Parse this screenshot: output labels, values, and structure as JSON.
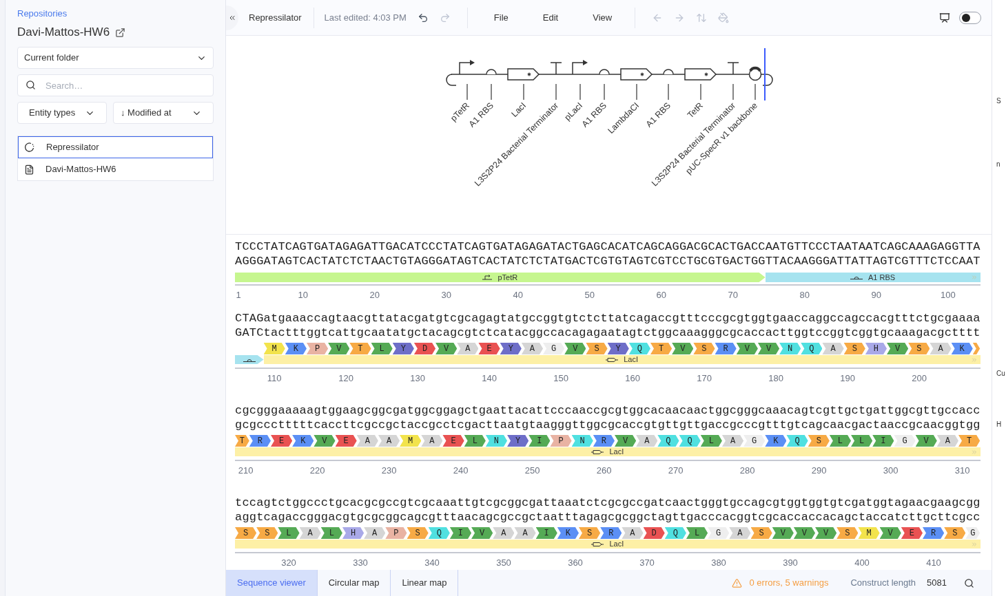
{
  "sidebar": {
    "breadcrumb": "Repositories",
    "title": "Davi-Mattos-HW6",
    "folder_select": "Current folder",
    "search": {
      "placeholder": "Search…"
    },
    "filters": [
      {
        "label": "Entity types"
      },
      {
        "label": "↓ Modified at"
      }
    ],
    "items": [
      {
        "kind": "construct",
        "label": "Repressilator",
        "selected": true
      },
      {
        "kind": "document",
        "label": "Davi-Mattos-HW6",
        "selected": false
      }
    ]
  },
  "toolbar": {
    "document_title": "Repressilator",
    "last_edited": "Last edited: 4:03 PM",
    "history": [
      {
        "kind": "undo",
        "disabled": false
      },
      {
        "kind": "redo",
        "disabled": true
      }
    ],
    "menus": [
      "File",
      "Edit",
      "View"
    ],
    "tools": [
      {
        "kind": "back",
        "disabled": true
      },
      {
        "kind": "forward",
        "disabled": true
      },
      {
        "kind": "flip",
        "disabled": true
      },
      {
        "kind": "paint",
        "disabled": true
      }
    ],
    "preview_toggle": {
      "on": false
    }
  },
  "diagram": {
    "parts": [
      {
        "kind": "promoter",
        "label": "pTetR"
      },
      {
        "kind": "rbs",
        "label": "A1 RBS"
      },
      {
        "kind": "cds",
        "label": "LacI"
      },
      {
        "kind": "terminator",
        "label": "L3S2P24 Bacterial Terminator"
      },
      {
        "kind": "promoter",
        "label": "pLacI"
      },
      {
        "kind": "rbs",
        "label": "A1 RBS"
      },
      {
        "kind": "cds",
        "label": "LambdaCI"
      },
      {
        "kind": "rbs",
        "label": "A1 RBS"
      },
      {
        "kind": "cds",
        "label": "TetR"
      },
      {
        "kind": "terminator",
        "label": "L3S2P24 Bacterial Terminator"
      },
      {
        "kind": "origin",
        "label": "pUC-SpecR v1 backbone"
      }
    ]
  },
  "sequence": {
    "lines": [
      {
        "top": "TCCCTATCAGTGATAGAGATTGACATCCCTATCAGTGATAGAGATACTGAGCACATCAGCAGGACGCACTGACCAATGTTCCCTAATAATCAGCAAAGAGGTTA",
        "bottom": "AGGGATAGTCACTATCTCTAACTGTAGGGATAGTCACTATCTCTATGACTCGTGTAGTCGTCCTGCGTGACTGGTTACAAGGGATTATTAGTCGTTTCTCCAAT",
        "features": [
          {
            "kind": "promoter",
            "label": "pTetR",
            "color": "#c6f68f",
            "continues": false
          },
          {
            "kind": "rbs",
            "label": "A1 RBS",
            "color": "#a6e3ef",
            "continues": true
          }
        ],
        "ticks": [
          "1",
          "10",
          "20",
          "30",
          "40",
          "50",
          "60",
          "70",
          "80",
          "90",
          "100"
        ]
      },
      {
        "top": "CTAGatgaaaccagtaacgttatacgatgtcgcagagtatgccggtgtctcttatcagaccgtttcccgcgtggtgaaccaggccagccacgtttctgcgaaaa",
        "bottom": "GATCtactttggtcattgcaatatgctacagcgtctcatacggccacagagaatagtctggcaaagggcgcaccacttggtccggtcggtgcaaagacgctttt",
        "aminos": [
          {
            "kind": "gap"
          },
          {
            "kind": "codon",
            "letter": "M",
            "color": "#f2e34c"
          },
          {
            "kind": "codon",
            "letter": "K",
            "color": "#5b8ff5"
          },
          {
            "kind": "codon",
            "letter": "P",
            "color": "#e9b3a3"
          },
          {
            "kind": "codon",
            "letter": "V",
            "color": "#55aa55"
          },
          {
            "kind": "codon",
            "letter": "T",
            "color": "#f7aa45"
          },
          {
            "kind": "codon",
            "letter": "L",
            "color": "#55aa55"
          },
          {
            "kind": "codon",
            "letter": "Y",
            "color": "#6e6ec8"
          },
          {
            "kind": "codon",
            "letter": "D",
            "color": "#e95252"
          },
          {
            "kind": "codon",
            "letter": "V",
            "color": "#55aa55"
          },
          {
            "kind": "codon",
            "letter": "A",
            "color": "#d5d5d5"
          },
          {
            "kind": "codon",
            "letter": "E",
            "color": "#e95252"
          },
          {
            "kind": "codon",
            "letter": "Y",
            "color": "#6e6ec8"
          },
          {
            "kind": "codon",
            "letter": "A",
            "color": "#d5d5d5"
          },
          {
            "kind": "codon",
            "letter": "G",
            "color": "#eeeeee"
          },
          {
            "kind": "codon",
            "letter": "V",
            "color": "#55aa55"
          },
          {
            "kind": "codon",
            "letter": "S",
            "color": "#f7aa45"
          },
          {
            "kind": "codon",
            "letter": "Y",
            "color": "#6e6ec8"
          },
          {
            "kind": "codon",
            "letter": "Q",
            "color": "#50e0e0"
          },
          {
            "kind": "codon",
            "letter": "T",
            "color": "#f7aa45"
          },
          {
            "kind": "codon",
            "letter": "V",
            "color": "#55aa55"
          },
          {
            "kind": "codon",
            "letter": "S",
            "color": "#f7aa45"
          },
          {
            "kind": "codon",
            "letter": "R",
            "color": "#5b8ff5"
          },
          {
            "kind": "codon",
            "letter": "V",
            "color": "#55aa55"
          },
          {
            "kind": "codon",
            "letter": "V",
            "color": "#55aa55"
          },
          {
            "kind": "codon",
            "letter": "N",
            "color": "#50e0e0"
          },
          {
            "kind": "codon",
            "letter": "Q",
            "color": "#50e0e0"
          },
          {
            "kind": "codon",
            "letter": "A",
            "color": "#d5d5d5"
          },
          {
            "kind": "codon",
            "letter": "S",
            "color": "#f7aa45"
          },
          {
            "kind": "codon",
            "letter": "H",
            "color": "#a9a9e8"
          },
          {
            "kind": "codon",
            "letter": "V",
            "color": "#55aa55"
          },
          {
            "kind": "codon",
            "letter": "S",
            "color": "#f7aa45"
          },
          {
            "kind": "codon",
            "letter": "A",
            "color": "#d5d5d5"
          },
          {
            "kind": "codon",
            "letter": "K",
            "color": "#5b8ff5"
          },
          {
            "kind": "tail1",
            "color": "#f7aa45"
          }
        ],
        "features": [
          {
            "kind": "rbs",
            "color": "#a6e3ef",
            "continues": false
          },
          {
            "kind": "cds",
            "label": "LacI",
            "color": "#fdf0a6",
            "continues": true
          }
        ],
        "ticks": [
          "110",
          "120",
          "130",
          "140",
          "150",
          "160",
          "170",
          "180",
          "190",
          "200"
        ]
      },
      {
        "top": "cgcgggaaaaagtggaagcggcgatggcggagctgaattacattcccaaccgcgtggcacaacaactggcgggcaaacagtcgttgctgattggcgttgccacc",
        "bottom": "gcgccctttttcaccttcgccgctaccgcctcgacttaatgtaagggttggcgcaccgtgttgttgaccgcccgtttgtcagcaacgactaaccgcaacggtgg",
        "aminos": [
          {
            "kind": "head2",
            "letter": "T",
            "color": "#f7aa45"
          },
          {
            "kind": "codon",
            "letter": "R",
            "color": "#5b8ff5"
          },
          {
            "kind": "codon",
            "letter": "E",
            "color": "#e95252"
          },
          {
            "kind": "codon",
            "letter": "K",
            "color": "#5b8ff5"
          },
          {
            "kind": "codon",
            "letter": "V",
            "color": "#55aa55"
          },
          {
            "kind": "codon",
            "letter": "E",
            "color": "#e95252"
          },
          {
            "kind": "codon",
            "letter": "A",
            "color": "#d5d5d5"
          },
          {
            "kind": "codon",
            "letter": "A",
            "color": "#d5d5d5"
          },
          {
            "kind": "codon",
            "letter": "M",
            "color": "#f2e34c"
          },
          {
            "kind": "codon",
            "letter": "A",
            "color": "#d5d5d5"
          },
          {
            "kind": "codon",
            "letter": "E",
            "color": "#e95252"
          },
          {
            "kind": "codon",
            "letter": "L",
            "color": "#55aa55"
          },
          {
            "kind": "codon",
            "letter": "N",
            "color": "#50e0e0"
          },
          {
            "kind": "codon",
            "letter": "Y",
            "color": "#6e6ec8"
          },
          {
            "kind": "codon",
            "letter": "I",
            "color": "#55aa55"
          },
          {
            "kind": "codon",
            "letter": "P",
            "color": "#e9b3a3"
          },
          {
            "kind": "codon",
            "letter": "N",
            "color": "#50e0e0"
          },
          {
            "kind": "codon",
            "letter": "R",
            "color": "#5b8ff5"
          },
          {
            "kind": "codon",
            "letter": "V",
            "color": "#55aa55"
          },
          {
            "kind": "codon",
            "letter": "A",
            "color": "#d5d5d5"
          },
          {
            "kind": "codon",
            "letter": "Q",
            "color": "#50e0e0"
          },
          {
            "kind": "codon",
            "letter": "Q",
            "color": "#50e0e0"
          },
          {
            "kind": "codon",
            "letter": "L",
            "color": "#55aa55"
          },
          {
            "kind": "codon",
            "letter": "A",
            "color": "#d5d5d5"
          },
          {
            "kind": "codon",
            "letter": "G",
            "color": "#eeeeee"
          },
          {
            "kind": "codon",
            "letter": "K",
            "color": "#5b8ff5"
          },
          {
            "kind": "codon",
            "letter": "Q",
            "color": "#50e0e0"
          },
          {
            "kind": "codon",
            "letter": "S",
            "color": "#f7aa45"
          },
          {
            "kind": "codon",
            "letter": "L",
            "color": "#55aa55"
          },
          {
            "kind": "codon",
            "letter": "L",
            "color": "#55aa55"
          },
          {
            "kind": "codon",
            "letter": "I",
            "color": "#55aa55"
          },
          {
            "kind": "codon",
            "letter": "G",
            "color": "#eeeeee"
          },
          {
            "kind": "codon",
            "letter": "V",
            "color": "#55aa55"
          },
          {
            "kind": "codon",
            "letter": "A",
            "color": "#d5d5d5"
          },
          {
            "kind": "codon",
            "letter": "T",
            "color": "#f7aa45"
          }
        ],
        "features": [
          {
            "kind": "cds",
            "label": "LacI",
            "color": "#fdf0a6",
            "continues": true
          }
        ],
        "ticks": [
          "210",
          "220",
          "230",
          "240",
          "250",
          "260",
          "270",
          "280",
          "290",
          "300",
          "310"
        ]
      },
      {
        "top": "tccagtctggccctgcacgcgccgtcgcaaattgtcgcggcgattaaatctcgcgccgatcaactgggtgccagcgtggtggtgtcgatggtagaacgaagcgg",
        "bottom": "aggtcagaccgggacgtgcgcggcagcgtttaacagcgccgctaatttagagcgcggctagttgacccacggtcgcaccaccacagctaccatcttgcttcgcc",
        "aminos": [
          {
            "kind": "codon",
            "letter": "S",
            "color": "#f7aa45"
          },
          {
            "kind": "codon",
            "letter": "S",
            "color": "#f7aa45"
          },
          {
            "kind": "codon",
            "letter": "L",
            "color": "#55aa55"
          },
          {
            "kind": "codon",
            "letter": "A",
            "color": "#d5d5d5"
          },
          {
            "kind": "codon",
            "letter": "L",
            "color": "#55aa55"
          },
          {
            "kind": "codon",
            "letter": "H",
            "color": "#a9a9e8"
          },
          {
            "kind": "codon",
            "letter": "A",
            "color": "#d5d5d5"
          },
          {
            "kind": "codon",
            "letter": "P",
            "color": "#e9b3a3"
          },
          {
            "kind": "codon",
            "letter": "S",
            "color": "#f7aa45"
          },
          {
            "kind": "codon",
            "letter": "Q",
            "color": "#50e0e0"
          },
          {
            "kind": "codon",
            "letter": "I",
            "color": "#55aa55"
          },
          {
            "kind": "codon",
            "letter": "V",
            "color": "#55aa55"
          },
          {
            "kind": "codon",
            "letter": "A",
            "color": "#d5d5d5"
          },
          {
            "kind": "codon",
            "letter": "A",
            "color": "#d5d5d5"
          },
          {
            "kind": "codon",
            "letter": "I",
            "color": "#55aa55"
          },
          {
            "kind": "codon",
            "letter": "K",
            "color": "#5b8ff5"
          },
          {
            "kind": "codon",
            "letter": "S",
            "color": "#f7aa45"
          },
          {
            "kind": "codon",
            "letter": "R",
            "color": "#5b8ff5"
          },
          {
            "kind": "codon",
            "letter": "A",
            "color": "#d5d5d5"
          },
          {
            "kind": "codon",
            "letter": "D",
            "color": "#e95252"
          },
          {
            "kind": "codon",
            "letter": "Q",
            "color": "#50e0e0"
          },
          {
            "kind": "codon",
            "letter": "L",
            "color": "#55aa55"
          },
          {
            "kind": "codon",
            "letter": "G",
            "color": "#eeeeee"
          },
          {
            "kind": "codon",
            "letter": "A",
            "color": "#d5d5d5"
          },
          {
            "kind": "codon",
            "letter": "S",
            "color": "#f7aa45"
          },
          {
            "kind": "codon",
            "letter": "V",
            "color": "#55aa55"
          },
          {
            "kind": "codon",
            "letter": "V",
            "color": "#55aa55"
          },
          {
            "kind": "codon",
            "letter": "V",
            "color": "#55aa55"
          },
          {
            "kind": "codon",
            "letter": "S",
            "color": "#f7aa45"
          },
          {
            "kind": "codon",
            "letter": "M",
            "color": "#f2e34c"
          },
          {
            "kind": "codon",
            "letter": "V",
            "color": "#55aa55"
          },
          {
            "kind": "codon",
            "letter": "E",
            "color": "#e95252"
          },
          {
            "kind": "codon",
            "letter": "R",
            "color": "#5b8ff5"
          },
          {
            "kind": "codon",
            "letter": "S",
            "color": "#f7aa45"
          },
          {
            "kind": "tail2",
            "letter": "G",
            "color": "#eeeeee"
          }
        ],
        "features": [
          {
            "kind": "cds",
            "label": "LacI",
            "color": "#fdf0a6",
            "continues": true
          }
        ],
        "ticks": [
          "320",
          "330",
          "340",
          "350",
          "360",
          "370",
          "380",
          "390",
          "400",
          "410"
        ]
      }
    ]
  },
  "bottom_bar": {
    "tabs": [
      {
        "label": "Sequence viewer",
        "selected": true
      },
      {
        "label": "Circular map",
        "selected": false
      },
      {
        "label": "Linear map",
        "selected": false
      }
    ],
    "status": "0 errors, 5 warnings",
    "length_label": "Construct length",
    "length": "5081"
  },
  "right_edge": [
    "S",
    "n",
    "Cu",
    "H"
  ]
}
